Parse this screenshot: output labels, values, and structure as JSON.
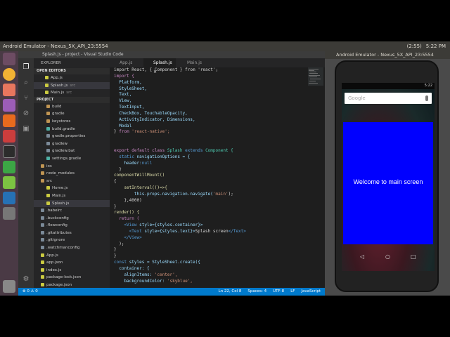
{
  "topbar": {
    "title": "Android Emulator - Nexus_5X_API_23:5554",
    "tray": [
      "(2:55)",
      "5:22 PM"
    ]
  },
  "vscode": {
    "title": "Splash.js - project - Visual Studio Code",
    "explorer_label": "EXPLORER",
    "open_editors_label": "OPEN EDITORS",
    "project_label": "PROJECT",
    "open_editors": [
      {
        "name": "App.js",
        "badge": ""
      },
      {
        "name": "Splash.js",
        "badge": "src"
      },
      {
        "name": "Main.js",
        "badge": "src"
      }
    ],
    "tree": [
      {
        "name": "build",
        "type": "folder",
        "indent": 1
      },
      {
        "name": "gradle",
        "type": "folder",
        "indent": 1
      },
      {
        "name": "keystores",
        "type": "folder",
        "indent": 1
      },
      {
        "name": "build.gradle",
        "type": "gradle",
        "indent": 1
      },
      {
        "name": "gradle.properties",
        "type": "file",
        "indent": 1
      },
      {
        "name": "gradlew",
        "type": "file",
        "indent": 1
      },
      {
        "name": "gradlew.bat",
        "type": "file",
        "indent": 1
      },
      {
        "name": "settings.gradle",
        "type": "gradle",
        "indent": 1
      },
      {
        "name": "ios",
        "type": "folder",
        "indent": 0
      },
      {
        "name": "node_modules",
        "type": "folder",
        "indent": 0
      },
      {
        "name": "src",
        "type": "folder",
        "indent": 0
      },
      {
        "name": "Home.js",
        "type": "js",
        "indent": 1
      },
      {
        "name": "Main.js",
        "type": "js",
        "indent": 1
      },
      {
        "name": "Splash.js",
        "type": "js",
        "indent": 1,
        "selected": true
      },
      {
        "name": ".babelrc",
        "type": "file",
        "indent": 0
      },
      {
        "name": ".buckconfig",
        "type": "file",
        "indent": 0
      },
      {
        "name": ".flowconfig",
        "type": "file",
        "indent": 0
      },
      {
        "name": ".gitattributes",
        "type": "file",
        "indent": 0
      },
      {
        "name": ".gitignore",
        "type": "file",
        "indent": 0
      },
      {
        "name": ".watchmanconfig",
        "type": "file",
        "indent": 0
      },
      {
        "name": "App.js",
        "type": "js",
        "indent": 0
      },
      {
        "name": "app.json",
        "type": "json",
        "indent": 0
      },
      {
        "name": "index.js",
        "type": "js",
        "indent": 0
      },
      {
        "name": "package-lock.json",
        "type": "json",
        "indent": 0
      },
      {
        "name": "package.json",
        "type": "json",
        "indent": 0
      }
    ],
    "tabs": [
      {
        "label": "App.js",
        "active": false
      },
      {
        "label": "Splash.js",
        "active": true
      },
      {
        "label": "Main.js",
        "active": false
      }
    ],
    "code": [
      [
        [
          "import React, { Component } from 'react';",
          "#d4d4d4"
        ]
      ],
      [
        [
          "import {",
          "#c586c0"
        ]
      ],
      [
        [
          "  Platform,",
          "#9cdcfe"
        ]
      ],
      [
        [
          "  StyleSheet,",
          "#9cdcfe"
        ]
      ],
      [
        [
          "  Text,",
          "#9cdcfe"
        ]
      ],
      [
        [
          "  View,",
          "#9cdcfe"
        ]
      ],
      [
        [
          "  TextInput,",
          "#9cdcfe"
        ]
      ],
      [
        [
          "  CheckBox, TouchableOpacity,",
          "#9cdcfe"
        ]
      ],
      [
        [
          "  ActivityIndicator, Dimensions,",
          "#9cdcfe"
        ]
      ],
      [
        [
          "  Modal",
          "#9cdcfe"
        ]
      ],
      [
        [
          "} ",
          "#d4d4d4"
        ],
        [
          "from ",
          "#c586c0"
        ],
        [
          "'react-native';",
          "#ce9178"
        ]
      ],
      [
        [
          "",
          ""
        ]
      ],
      [
        [
          "",
          ""
        ]
      ],
      [
        [
          "export default class ",
          "#c586c0"
        ],
        [
          "Splash ",
          "#4ec9b0"
        ],
        [
          "extends ",
          "#569cd6"
        ],
        [
          "Component {",
          "#4ec9b0"
        ]
      ],
      [
        [
          "  static ",
          "#569cd6"
        ],
        [
          "navigationOptions = {",
          "#9cdcfe"
        ]
      ],
      [
        [
          "    header:",
          "#9cdcfe"
        ],
        [
          "null",
          "#569cd6"
        ]
      ],
      [
        [
          "  }",
          "#d4d4d4"
        ]
      ],
      [
        [
          "componentWillMount()",
          "#dcdcaa"
        ]
      ],
      [
        [
          "{",
          "#d4d4d4"
        ]
      ],
      [
        [
          "    setInterval(()=>{",
          "#dcdcaa"
        ]
      ],
      [
        [
          "        this.props.navigation.navigate(",
          "#9cdcfe"
        ],
        [
          "'main'",
          "#ce9178"
        ],
        [
          ");",
          "#d4d4d4"
        ]
      ],
      [
        [
          "    },4000)",
          "#d4d4d4"
        ]
      ],
      [
        [
          "}",
          "#d4d4d4"
        ]
      ],
      [
        [
          "render() {",
          "#dcdcaa"
        ]
      ],
      [
        [
          "  return (",
          "#c586c0"
        ]
      ],
      [
        [
          "    <View ",
          "#569cd6"
        ],
        [
          "style={styles.container}>",
          "#9cdcfe"
        ]
      ],
      [
        [
          "      <Text ",
          "#569cd6"
        ],
        [
          "style={styles.text}>",
          "#9cdcfe"
        ],
        [
          "Splash screen",
          "#d4d4d4"
        ],
        [
          "</Text>",
          "#569cd6"
        ]
      ],
      [
        [
          "    </View>",
          "#569cd6"
        ]
      ],
      [
        [
          "  );",
          "#d4d4d4"
        ]
      ],
      [
        [
          "}",
          "#d4d4d4"
        ]
      ],
      [
        [
          "}",
          "#d4d4d4"
        ]
      ],
      [
        [
          "const ",
          "#569cd6"
        ],
        [
          "styles = StyleSheet.create({",
          "#9cdcfe"
        ]
      ],
      [
        [
          "  container: {",
          "#9cdcfe"
        ]
      ],
      [
        [
          "    alignItems: ",
          "#9cdcfe"
        ],
        [
          "'center',",
          "#ce9178"
        ]
      ],
      [
        [
          "    backgroundColor: ",
          "#9cdcfe"
        ],
        [
          "'skyblue',",
          "#ce9178"
        ]
      ]
    ],
    "status": {
      "left": "⊗ 0 ⚠ 0",
      "cursor": "Ln 22, Col 8",
      "spaces": "Spaces: 4",
      "encoding": "UTF-8",
      "eol": "LF",
      "language": "JavaScript"
    }
  },
  "emulator": {
    "title": "Android Emulator - Nexus_5X_API_23:5554",
    "time": "5:22",
    "search_placeholder": "Google",
    "splash_text": "Welcome to main screen",
    "nav": [
      "◁",
      "○",
      "□"
    ]
  }
}
